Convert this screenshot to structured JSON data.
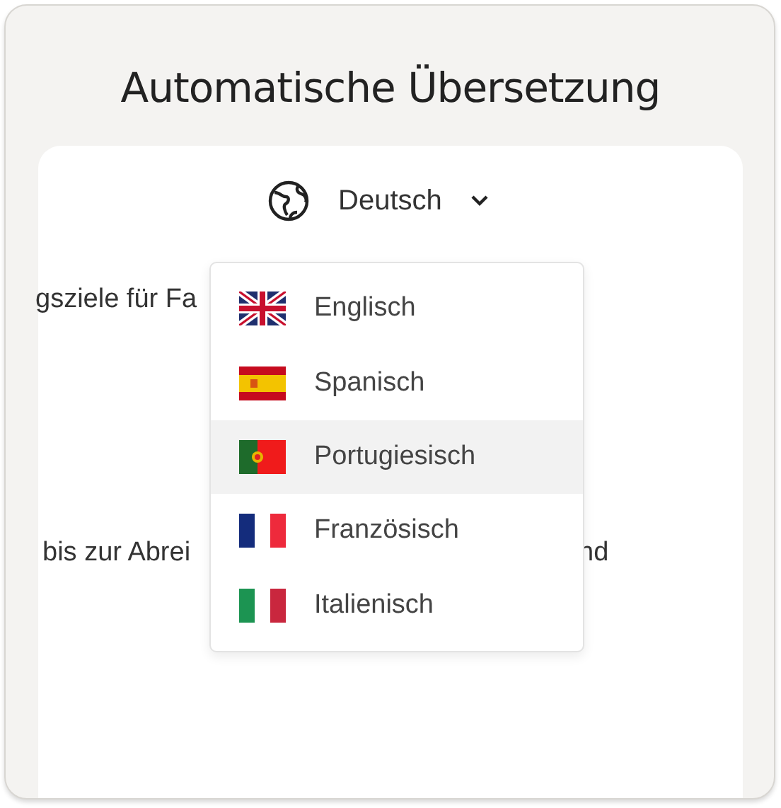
{
  "title": "Automatische Übersetzung",
  "language_select": {
    "value": "Deutsch",
    "expanded": true
  },
  "background_text": [
    {
      "text": "gsziele für Fa"
    },
    {
      "text": "bis zur Abrei"
    },
    {
      "text": "nd"
    }
  ],
  "menu": [
    {
      "label": "Englisch",
      "kind": "uk",
      "selected": false
    },
    {
      "label": "Spanisch",
      "kind": "es",
      "selected": false
    },
    {
      "label": "Portugiesisch",
      "kind": "pt",
      "selected": true
    },
    {
      "label": "Französisch",
      "kind": "fr",
      "selected": false
    },
    {
      "label": "Italienisch",
      "kind": "it",
      "selected": false
    }
  ]
}
